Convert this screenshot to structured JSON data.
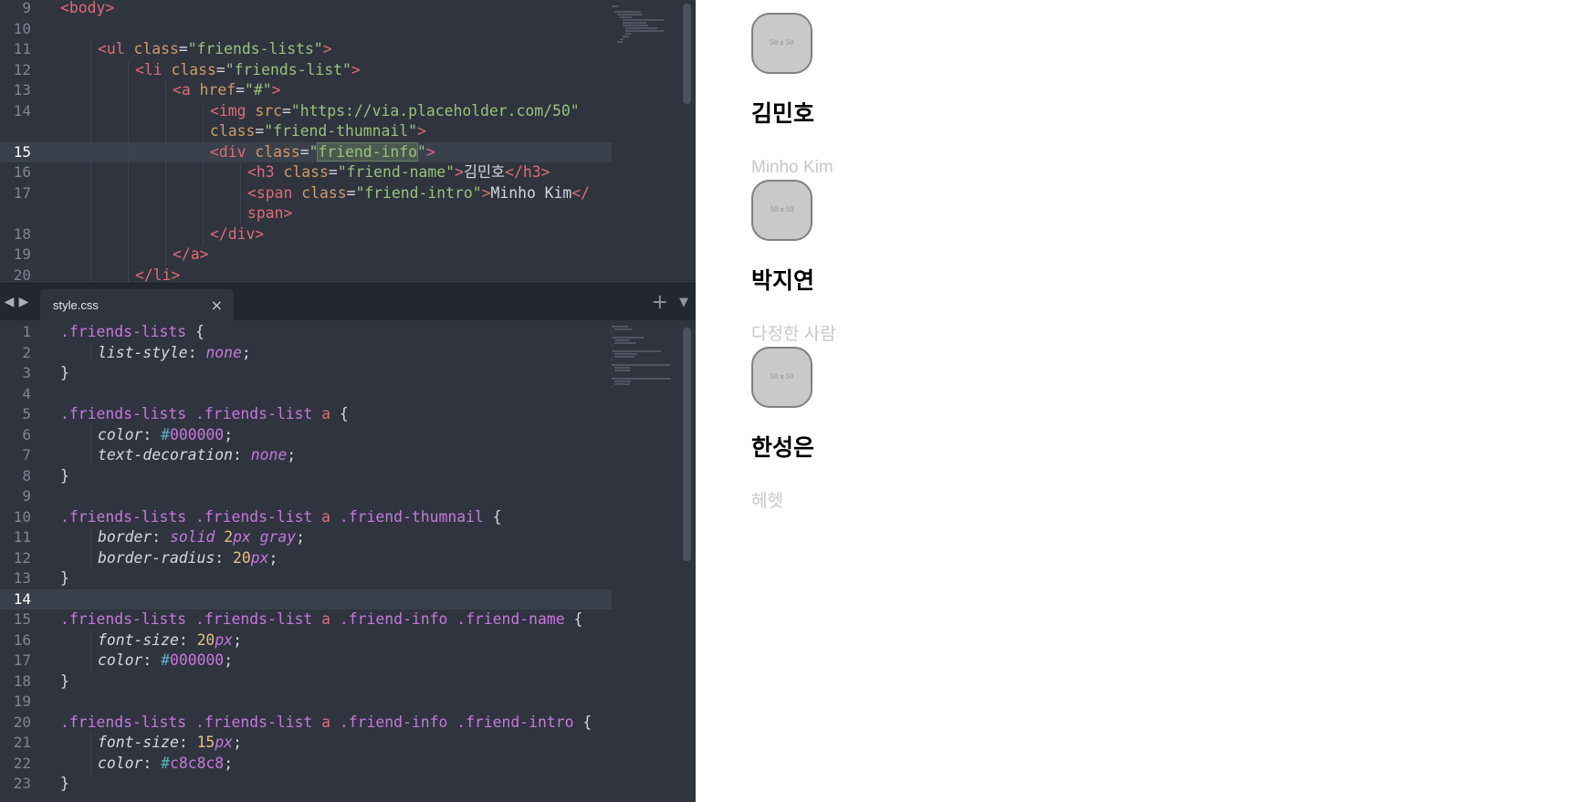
{
  "editor": {
    "top_pane": {
      "active_line": "15",
      "lines": [
        {
          "n": "9",
          "indent": 0,
          "tokens": [
            [
              "tag",
              "<body>"
            ]
          ]
        },
        {
          "n": "10",
          "indent": 0,
          "tokens": []
        },
        {
          "n": "11",
          "indent": 1,
          "tokens": [
            [
              "tag",
              "<ul "
            ],
            [
              "attr",
              "class"
            ],
            [
              "pun",
              "="
            ],
            [
              "str",
              "\"friends-lists\""
            ],
            [
              "tag",
              ">"
            ]
          ]
        },
        {
          "n": "12",
          "indent": 2,
          "tokens": [
            [
              "tag",
              "<li "
            ],
            [
              "attr",
              "class"
            ],
            [
              "pun",
              "="
            ],
            [
              "str",
              "\"friends-list\""
            ],
            [
              "tag",
              ">"
            ]
          ]
        },
        {
          "n": "13",
          "indent": 3,
          "tokens": [
            [
              "tag",
              "<a "
            ],
            [
              "attr",
              "href"
            ],
            [
              "pun",
              "="
            ],
            [
              "str",
              "\"#\""
            ],
            [
              "tag",
              ">"
            ]
          ]
        },
        {
          "n": "14",
          "indent": 4,
          "tokens": [
            [
              "tag",
              "<img "
            ],
            [
              "attr",
              "src"
            ],
            [
              "pun",
              "="
            ],
            [
              "str",
              "\"https://via.placeholder.com/50\""
            ]
          ]
        },
        {
          "n": "",
          "indent": 4,
          "tokens": [
            [
              "attr",
              "class"
            ],
            [
              "pun",
              "="
            ],
            [
              "str",
              "\"friend-thumnail\""
            ],
            [
              "tag",
              ">"
            ]
          ]
        },
        {
          "n": "15",
          "indent": 4,
          "tokens": [
            [
              "tag",
              "<div "
            ],
            [
              "attr",
              "class"
            ],
            [
              "pun",
              "="
            ],
            [
              "str",
              "\""
            ],
            [
              "mark",
              "friend-info"
            ],
            [
              "str",
              "\""
            ],
            [
              "tag",
              ">"
            ]
          ]
        },
        {
          "n": "16",
          "indent": 5,
          "tokens": [
            [
              "tag",
              "<h3 "
            ],
            [
              "attr",
              "class"
            ],
            [
              "pun",
              "="
            ],
            [
              "str",
              "\"friend-name\""
            ],
            [
              "tag",
              ">"
            ],
            [
              "plain",
              "김민호"
            ],
            [
              "tag",
              "</h3>"
            ]
          ]
        },
        {
          "n": "17",
          "indent": 5,
          "tokens": [
            [
              "tag",
              "<span "
            ],
            [
              "attr",
              "class"
            ],
            [
              "pun",
              "="
            ],
            [
              "str",
              "\"friend-intro\""
            ],
            [
              "tag",
              ">"
            ],
            [
              "plain",
              "Minho Kim"
            ],
            [
              "tag",
              "</"
            ]
          ]
        },
        {
          "n": "",
          "indent": 5,
          "tokens": [
            [
              "tag",
              "span>"
            ]
          ]
        },
        {
          "n": "18",
          "indent": 4,
          "tokens": [
            [
              "tag",
              "</div>"
            ]
          ]
        },
        {
          "n": "19",
          "indent": 3,
          "tokens": [
            [
              "tag",
              "</a>"
            ]
          ]
        },
        {
          "n": "20",
          "indent": 2,
          "tokens": [
            [
              "tag",
              "</li>"
            ]
          ]
        }
      ]
    },
    "tab": {
      "label": "style.css",
      "close_glyph": "×"
    },
    "tab_controls": {
      "back_glyph": "◀",
      "forward_glyph": "▶",
      "plus_glyph": "+",
      "menu_glyph": "▼"
    },
    "bottom_pane": {
      "active_line": "14",
      "lines": [
        {
          "n": "1",
          "indent": 0,
          "tokens": [
            [
              "sel",
              ".friends-lists"
            ],
            [
              "pun",
              " {"
            ]
          ]
        },
        {
          "n": "2",
          "indent": 1,
          "tokens": [
            [
              "prop",
              "list-style"
            ],
            [
              "pun",
              ": "
            ],
            [
              "val",
              "none"
            ],
            [
              "pun",
              ";"
            ]
          ]
        },
        {
          "n": "3",
          "indent": 0,
          "tokens": [
            [
              "pun",
              "}"
            ]
          ]
        },
        {
          "n": "4",
          "indent": 0,
          "tokens": []
        },
        {
          "n": "5",
          "indent": 0,
          "tokens": [
            [
              "sel",
              ".friends-lists .friends-list "
            ],
            [
              "tag",
              "a"
            ],
            [
              "pun",
              " {"
            ]
          ]
        },
        {
          "n": "6",
          "indent": 1,
          "tokens": [
            [
              "prop",
              "color"
            ],
            [
              "pun",
              ": "
            ],
            [
              "hash",
              "#"
            ],
            [
              "hex",
              "000000"
            ],
            [
              "pun",
              ";"
            ]
          ]
        },
        {
          "n": "7",
          "indent": 1,
          "tokens": [
            [
              "prop",
              "text-decoration"
            ],
            [
              "pun",
              ": "
            ],
            [
              "val",
              "none"
            ],
            [
              "pun",
              ";"
            ]
          ]
        },
        {
          "n": "8",
          "indent": 0,
          "tokens": [
            [
              "pun",
              "}"
            ]
          ]
        },
        {
          "n": "9",
          "indent": 0,
          "tokens": []
        },
        {
          "n": "10",
          "indent": 0,
          "tokens": [
            [
              "sel",
              ".friends-lists .friends-list "
            ],
            [
              "tag",
              "a"
            ],
            [
              "sel",
              " .friend-thumnail"
            ],
            [
              "pun",
              " {"
            ]
          ]
        },
        {
          "n": "11",
          "indent": 1,
          "tokens": [
            [
              "prop",
              "border"
            ],
            [
              "pun",
              ": "
            ],
            [
              "val",
              "solid "
            ],
            [
              "num",
              "2"
            ],
            [
              "unit",
              "px"
            ],
            [
              "val",
              " gray"
            ],
            [
              "pun",
              ";"
            ]
          ]
        },
        {
          "n": "12",
          "indent": 1,
          "tokens": [
            [
              "prop",
              "border-radius"
            ],
            [
              "pun",
              ": "
            ],
            [
              "num",
              "20"
            ],
            [
              "unit",
              "px"
            ],
            [
              "pun",
              ";"
            ]
          ]
        },
        {
          "n": "13",
          "indent": 0,
          "tokens": [
            [
              "pun",
              "}"
            ]
          ]
        },
        {
          "n": "14",
          "indent": 0,
          "tokens": []
        },
        {
          "n": "15",
          "indent": 0,
          "tokens": [
            [
              "sel",
              ".friends-lists .friends-list "
            ],
            [
              "tag",
              "a"
            ],
            [
              "sel",
              " .friend-info .friend-name"
            ],
            [
              "pun",
              " {"
            ]
          ]
        },
        {
          "n": "16",
          "indent": 1,
          "tokens": [
            [
              "prop",
              "font-size"
            ],
            [
              "pun",
              ": "
            ],
            [
              "num",
              "20"
            ],
            [
              "unit",
              "px"
            ],
            [
              "pun",
              ";"
            ]
          ]
        },
        {
          "n": "17",
          "indent": 1,
          "tokens": [
            [
              "prop",
              "color"
            ],
            [
              "pun",
              ": "
            ],
            [
              "hash",
              "#"
            ],
            [
              "hex",
              "000000"
            ],
            [
              "pun",
              ";"
            ]
          ]
        },
        {
          "n": "18",
          "indent": 0,
          "tokens": [
            [
              "pun",
              "}"
            ]
          ]
        },
        {
          "n": "19",
          "indent": 0,
          "tokens": []
        },
        {
          "n": "20",
          "indent": 0,
          "tokens": [
            [
              "sel",
              ".friends-lists .friends-list "
            ],
            [
              "tag",
              "a"
            ],
            [
              "sel",
              " .friend-info .friend-intro"
            ],
            [
              "pun",
              " {"
            ]
          ]
        },
        {
          "n": "21",
          "indent": 1,
          "tokens": [
            [
              "prop",
              "font-size"
            ],
            [
              "pun",
              ": "
            ],
            [
              "num",
              "15"
            ],
            [
              "unit",
              "px"
            ],
            [
              "pun",
              ";"
            ]
          ]
        },
        {
          "n": "22",
          "indent": 1,
          "tokens": [
            [
              "prop",
              "color"
            ],
            [
              "pun",
              ": "
            ],
            [
              "hash",
              "#"
            ],
            [
              "hex",
              "c8c8c8"
            ],
            [
              "pun",
              ";"
            ]
          ]
        },
        {
          "n": "23",
          "indent": 0,
          "tokens": [
            [
              "pun",
              "}"
            ]
          ]
        }
      ]
    },
    "colors": {
      "background": "#2f343f",
      "tag": "#e06c75",
      "attribute": "#d19a66",
      "string": "#98c379",
      "selector": "#c678dd",
      "number": "#e5c07b"
    }
  },
  "preview": {
    "friends": [
      {
        "thumb_text": "50 x 50",
        "name": "김민호",
        "intro": "Minho Kim"
      },
      {
        "thumb_text": "50 x 50",
        "name": "박지연",
        "intro": "다정한 사람"
      },
      {
        "thumb_text": "50 x 50",
        "name": "한성은",
        "intro": "헤헷"
      }
    ],
    "colors": {
      "name": "#000000",
      "intro": "#c8c8c8",
      "thumb_border": "#808080"
    }
  }
}
